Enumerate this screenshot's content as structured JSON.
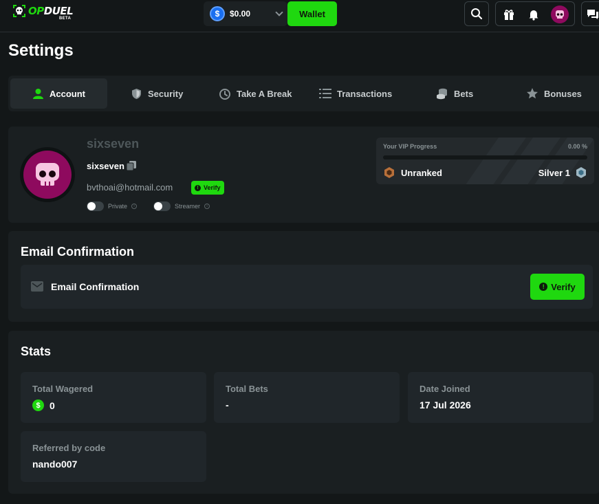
{
  "topbar": {
    "logo_prefix": "OP",
    "logo_suffix": "DUEL",
    "logo_badge": "BETA",
    "balance": "$0.00",
    "currency_symbol": "$",
    "wallet_label": "Wallet"
  },
  "page_title": "Settings",
  "tabs": [
    {
      "label": "Account",
      "icon": "user-icon",
      "active": true
    },
    {
      "label": "Security",
      "icon": "shield-icon",
      "active": false
    },
    {
      "label": "Take A Break",
      "icon": "timer-icon",
      "active": false
    },
    {
      "label": "Transactions",
      "icon": "list-icon",
      "active": false
    },
    {
      "label": "Bets",
      "icon": "coins-icon",
      "active": false
    },
    {
      "label": "Bonuses",
      "icon": "star-icon",
      "active": false
    }
  ],
  "profile": {
    "display_name": "sixseven",
    "username": "sixseven",
    "email": "bvthoai@hotmail.com",
    "verify_label": "Verify",
    "toggles": [
      {
        "label": "Private",
        "on": false
      },
      {
        "label": "Streamer",
        "on": false
      }
    ]
  },
  "vip": {
    "label": "Your VIP Progress",
    "percent_text": "0.00 %",
    "progress": 0,
    "current_rank": "Unranked",
    "next_rank": "Silver 1"
  },
  "email_confirmation": {
    "title": "Email Confirmation",
    "row_label": "Email Confirmation",
    "button_label": "Verify"
  },
  "stats": {
    "title": "Stats",
    "items": [
      {
        "label": "Total Wagered",
        "value": "0"
      },
      {
        "label": "Total Bets",
        "value": "-"
      },
      {
        "label": "Date Joined",
        "value": "17 Jul 2026"
      },
      {
        "label": "Referred by code",
        "value": "nando007"
      }
    ]
  },
  "colors": {
    "accent": "#1fd80f",
    "background": "#131718",
    "panel": "#1a1f21",
    "avatar": "#8e0a5e"
  }
}
